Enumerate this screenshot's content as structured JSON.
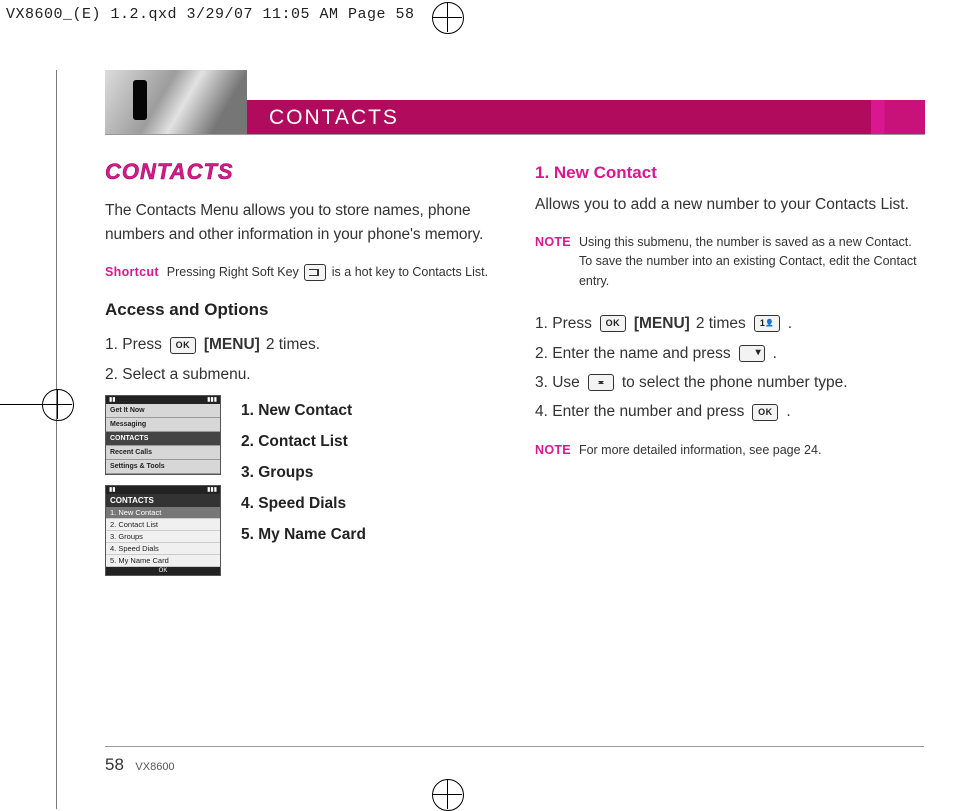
{
  "print_header": "VX8600_(E) 1.2.qxd  3/29/07  11:05 AM  Page 58",
  "section_title": "CONTACTS",
  "left": {
    "heading": "CONTACTS",
    "intro": "The Contacts Menu allows you to store names, phone numbers and other information in your phone's memory.",
    "shortcut_label": "Shortcut",
    "shortcut_text_a": "Pressing Right Soft Key ",
    "shortcut_text_b": " is a hot key to Contacts List.",
    "access_heading": "Access and Options",
    "step1_a": "1.  Press ",
    "step1_ok": "OK",
    "step1_b": " [MENU]",
    "step1_c": " 2 times.",
    "step2": " 2.  Select a submenu.",
    "menu_items": [
      "1. New Contact",
      "2. Contact List",
      "3. Groups",
      "4. Speed Dials",
      "5. My Name Card"
    ],
    "screen1": {
      "items": [
        "Get It Now",
        "Messaging",
        "CONTACTS",
        "Recent Calls",
        "Settings & Tools"
      ]
    },
    "screen2": {
      "title": "CONTACTS",
      "items": [
        "1. New Contact",
        "2. Contact List",
        "3. Groups",
        "4. Speed Dials",
        "5. My Name Card"
      ],
      "ok": "OK"
    }
  },
  "right": {
    "heading": "1. New Contact",
    "intro": "Allows you to add a new number to your Contacts List.",
    "note1_label": "NOTE",
    "note1_text": "Using this submenu, the number is saved as a new Contact. To save the number into an existing Contact, edit the Contact entry.",
    "s1_a": "1. Press ",
    "s1_ok": "OK",
    "s1_b": " [MENU]",
    "s1_c": " 2 times ",
    "s1_key1": "1",
    "s1_d": " .",
    "s2_a": "2. Enter the name and press ",
    "s2_b": " .",
    "s3_a": "3. Use ",
    "s3_b": " to select the phone number type.",
    "s4_a": "4. Enter the number and press ",
    "s4_ok": "OK",
    "s4_b": " .",
    "note2_label": "NOTE",
    "note2_text": "For more detailed information, see page 24."
  },
  "footer": {
    "page": "58",
    "model": "VX8600"
  }
}
